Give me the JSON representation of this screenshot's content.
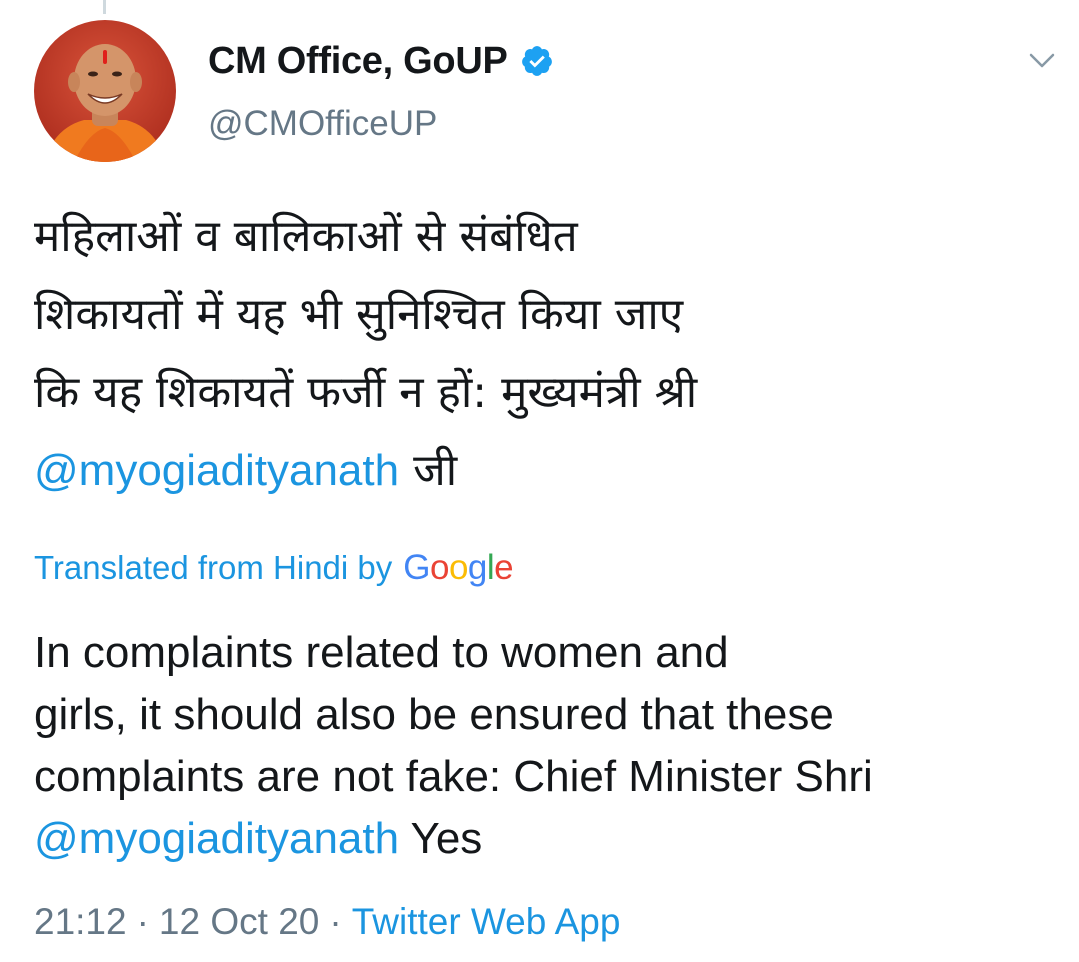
{
  "tweet": {
    "author": {
      "display_name": "CM Office, GoUP",
      "handle": "@CMOfficeUP",
      "verified": true,
      "avatar_icon": "profile-photo"
    },
    "original_text": {
      "line1": "महिलाओं व बालिकाओं से संबंधित",
      "line2": "शिकायतों में यह भी सुनिश्चित किया जाए",
      "line3": "कि यह शिकायतें फर्जी न हों: मुख्यमंत्री श्री",
      "line4_mention": "@myogiadityanath",
      "line4_rest": " जी"
    },
    "translation_label": "Translated from Hindi by",
    "google_logo": [
      "G",
      "o",
      "o",
      "g",
      "l",
      "e"
    ],
    "translated_text": {
      "line1": "In complaints related to women and",
      "line2": "girls, it should also be ensured that these",
      "line3": "complaints are not fake: Chief Minister Shri",
      "line4_mention": "@myogiadityanath",
      "line4_rest": " Yes"
    },
    "time": "21:12",
    "date": "12 Oct 20",
    "separator": "·",
    "source": "Twitter Web App",
    "menu_icon": "chevron-down-icon"
  },
  "colors": {
    "link": "#1b95e0",
    "text": "#14171a",
    "secondary": "#657786",
    "verified": "#1da1f2"
  }
}
